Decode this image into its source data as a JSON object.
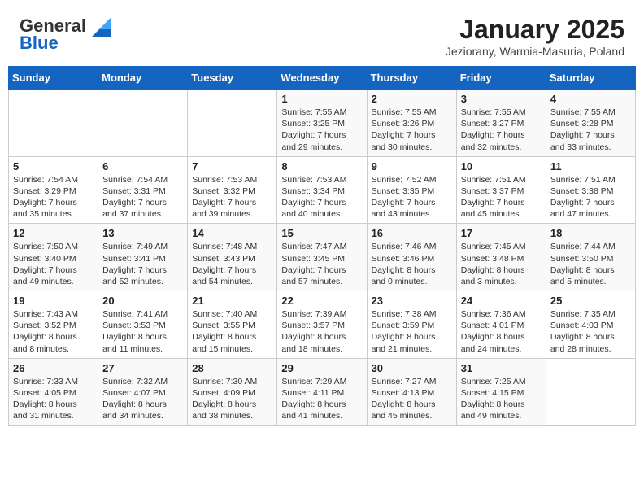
{
  "header": {
    "logo_general": "General",
    "logo_blue": "Blue",
    "title": "January 2025",
    "subtitle": "Jeziorany, Warmia-Masuria, Poland"
  },
  "weekdays": [
    "Sunday",
    "Monday",
    "Tuesday",
    "Wednesday",
    "Thursday",
    "Friday",
    "Saturday"
  ],
  "weeks": [
    [
      {
        "day": "",
        "info": ""
      },
      {
        "day": "",
        "info": ""
      },
      {
        "day": "",
        "info": ""
      },
      {
        "day": "1",
        "info": "Sunrise: 7:55 AM\nSunset: 3:25 PM\nDaylight: 7 hours and 29 minutes."
      },
      {
        "day": "2",
        "info": "Sunrise: 7:55 AM\nSunset: 3:26 PM\nDaylight: 7 hours and 30 minutes."
      },
      {
        "day": "3",
        "info": "Sunrise: 7:55 AM\nSunset: 3:27 PM\nDaylight: 7 hours and 32 minutes."
      },
      {
        "day": "4",
        "info": "Sunrise: 7:55 AM\nSunset: 3:28 PM\nDaylight: 7 hours and 33 minutes."
      }
    ],
    [
      {
        "day": "5",
        "info": "Sunrise: 7:54 AM\nSunset: 3:29 PM\nDaylight: 7 hours and 35 minutes."
      },
      {
        "day": "6",
        "info": "Sunrise: 7:54 AM\nSunset: 3:31 PM\nDaylight: 7 hours and 37 minutes."
      },
      {
        "day": "7",
        "info": "Sunrise: 7:53 AM\nSunset: 3:32 PM\nDaylight: 7 hours and 39 minutes."
      },
      {
        "day": "8",
        "info": "Sunrise: 7:53 AM\nSunset: 3:34 PM\nDaylight: 7 hours and 40 minutes."
      },
      {
        "day": "9",
        "info": "Sunrise: 7:52 AM\nSunset: 3:35 PM\nDaylight: 7 hours and 43 minutes."
      },
      {
        "day": "10",
        "info": "Sunrise: 7:51 AM\nSunset: 3:37 PM\nDaylight: 7 hours and 45 minutes."
      },
      {
        "day": "11",
        "info": "Sunrise: 7:51 AM\nSunset: 3:38 PM\nDaylight: 7 hours and 47 minutes."
      }
    ],
    [
      {
        "day": "12",
        "info": "Sunrise: 7:50 AM\nSunset: 3:40 PM\nDaylight: 7 hours and 49 minutes."
      },
      {
        "day": "13",
        "info": "Sunrise: 7:49 AM\nSunset: 3:41 PM\nDaylight: 7 hours and 52 minutes."
      },
      {
        "day": "14",
        "info": "Sunrise: 7:48 AM\nSunset: 3:43 PM\nDaylight: 7 hours and 54 minutes."
      },
      {
        "day": "15",
        "info": "Sunrise: 7:47 AM\nSunset: 3:45 PM\nDaylight: 7 hours and 57 minutes."
      },
      {
        "day": "16",
        "info": "Sunrise: 7:46 AM\nSunset: 3:46 PM\nDaylight: 8 hours and 0 minutes."
      },
      {
        "day": "17",
        "info": "Sunrise: 7:45 AM\nSunset: 3:48 PM\nDaylight: 8 hours and 3 minutes."
      },
      {
        "day": "18",
        "info": "Sunrise: 7:44 AM\nSunset: 3:50 PM\nDaylight: 8 hours and 5 minutes."
      }
    ],
    [
      {
        "day": "19",
        "info": "Sunrise: 7:43 AM\nSunset: 3:52 PM\nDaylight: 8 hours and 8 minutes."
      },
      {
        "day": "20",
        "info": "Sunrise: 7:41 AM\nSunset: 3:53 PM\nDaylight: 8 hours and 11 minutes."
      },
      {
        "day": "21",
        "info": "Sunrise: 7:40 AM\nSunset: 3:55 PM\nDaylight: 8 hours and 15 minutes."
      },
      {
        "day": "22",
        "info": "Sunrise: 7:39 AM\nSunset: 3:57 PM\nDaylight: 8 hours and 18 minutes."
      },
      {
        "day": "23",
        "info": "Sunrise: 7:38 AM\nSunset: 3:59 PM\nDaylight: 8 hours and 21 minutes."
      },
      {
        "day": "24",
        "info": "Sunrise: 7:36 AM\nSunset: 4:01 PM\nDaylight: 8 hours and 24 minutes."
      },
      {
        "day": "25",
        "info": "Sunrise: 7:35 AM\nSunset: 4:03 PM\nDaylight: 8 hours and 28 minutes."
      }
    ],
    [
      {
        "day": "26",
        "info": "Sunrise: 7:33 AM\nSunset: 4:05 PM\nDaylight: 8 hours and 31 minutes."
      },
      {
        "day": "27",
        "info": "Sunrise: 7:32 AM\nSunset: 4:07 PM\nDaylight: 8 hours and 34 minutes."
      },
      {
        "day": "28",
        "info": "Sunrise: 7:30 AM\nSunset: 4:09 PM\nDaylight: 8 hours and 38 minutes."
      },
      {
        "day": "29",
        "info": "Sunrise: 7:29 AM\nSunset: 4:11 PM\nDaylight: 8 hours and 41 minutes."
      },
      {
        "day": "30",
        "info": "Sunrise: 7:27 AM\nSunset: 4:13 PM\nDaylight: 8 hours and 45 minutes."
      },
      {
        "day": "31",
        "info": "Sunrise: 7:25 AM\nSunset: 4:15 PM\nDaylight: 8 hours and 49 minutes."
      },
      {
        "day": "",
        "info": ""
      }
    ]
  ]
}
